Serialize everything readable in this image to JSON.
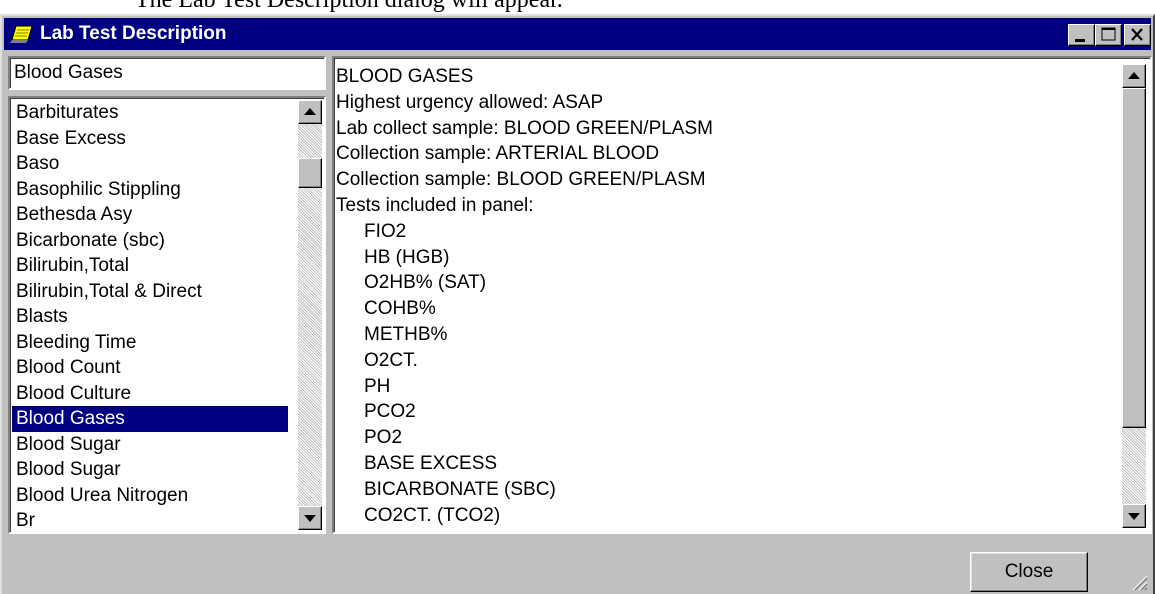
{
  "document": {
    "caption_fragment": "The Lab Test Description dialog will appear."
  },
  "window": {
    "title": "Lab Test Description",
    "icon": "notepad-icon",
    "controls": [
      "minimize-icon",
      "maximize-icon",
      "close-icon"
    ]
  },
  "search": {
    "value": "Blood Gases"
  },
  "test_list": {
    "items": [
      "Barbiturates",
      "Base Excess",
      "Baso",
      "Basophilic Stippling",
      "Bethesda Asy",
      "Bicarbonate (sbc)",
      "Bilirubin,Total",
      "Bilirubin,Total & Direct",
      "Blasts",
      "Bleeding Time",
      "Blood Count",
      "Blood Culture",
      "Blood Gases",
      "Blood Sugar",
      "Blood Sugar",
      "Blood Urea Nitrogen",
      "Br"
    ],
    "selected": "Blood Gases"
  },
  "description": {
    "header_lines": [
      "BLOOD GASES",
      "Highest urgency allowed: ASAP",
      "Lab collect sample: BLOOD  GREEN/PLASM",
      "Collection sample: ARTERIAL BLOOD",
      "Collection sample: BLOOD  GREEN/PLASM",
      "Tests included in panel:"
    ],
    "panel_tests": [
      "FIO2",
      "HB (HGB)",
      "O2HB% (SAT)",
      "COHB%",
      "METHB%",
      "O2CT.",
      "PH",
      "PCO2",
      "PO2",
      "BASE EXCESS",
      "BICARBONATE (SBC)",
      "CO2CT. (TCO2)"
    ]
  },
  "buttons": {
    "close_label": "Close"
  },
  "colors": {
    "titlebar": "#000080",
    "face": "#c0c0c0",
    "selection": "#000080"
  }
}
